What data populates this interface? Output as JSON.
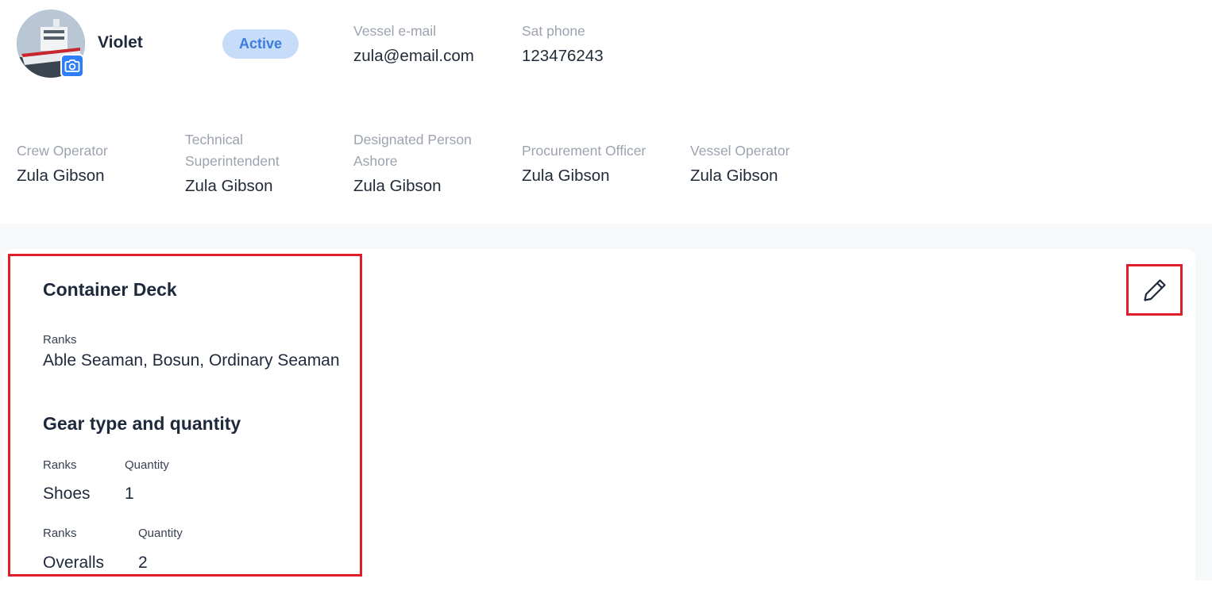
{
  "vessel": {
    "name": "Violet",
    "status": "Active",
    "email_label": "Vessel e-mail",
    "email": "zula@email.com",
    "phone_label": "Sat phone",
    "phone": "123476243"
  },
  "contacts": [
    {
      "label_line1": "Crew Operator",
      "label_line2": "",
      "value": "Zula Gibson"
    },
    {
      "label_line1": "Technical",
      "label_line2": "Superintendent",
      "value": "Zula Gibson"
    },
    {
      "label_line1": "Designated Person",
      "label_line2": "Ashore",
      "value": "Zula Gibson"
    },
    {
      "label_line1": "Procurement Officer",
      "label_line2": "",
      "value": "Zula Gibson"
    },
    {
      "label_line1": "Vessel Operator",
      "label_line2": "",
      "value": "Zula Gibson"
    }
  ],
  "department": {
    "title": "Container Deck",
    "ranks_label": "Ranks",
    "ranks_value": "Able Seaman, Bosun, Ordinary Seaman",
    "gear_title": "Gear type and quantity",
    "gear": [
      {
        "rank_label": "Ranks",
        "qty_label": "Quantity",
        "item": "Shoes",
        "quantity": "1"
      },
      {
        "rank_label": "Ranks",
        "qty_label": "Quantity",
        "item": "Overalls",
        "quantity": "2"
      }
    ]
  },
  "icons": {
    "camera": "camera-icon",
    "edit": "pencil-icon"
  },
  "colors": {
    "accent": "#2f7ef5",
    "status_bg": "#c7dcf9",
    "status_text": "#3b7ddd",
    "highlight": "#e11d2a"
  }
}
